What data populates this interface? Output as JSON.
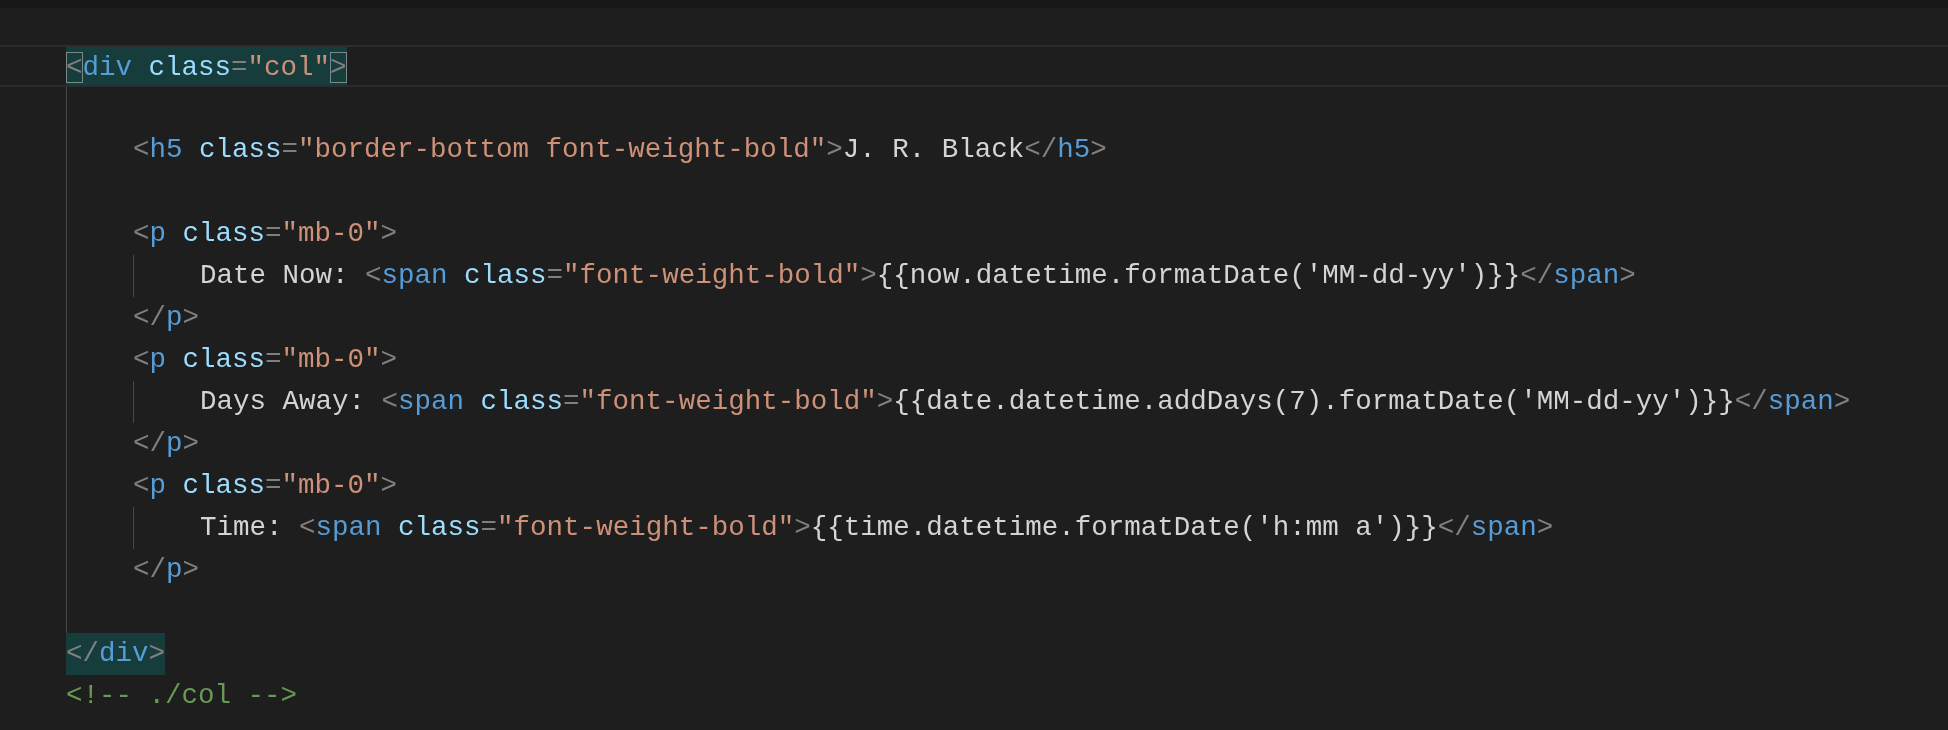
{
  "lines": [
    {
      "kind": "code",
      "current": true,
      "highlighted": true,
      "tokens": [
        {
          "kind": "punct",
          "text": "<",
          "boxed": true
        },
        {
          "kind": "tag",
          "text": "div",
          "boxed": false
        },
        {
          "kind": "attr",
          "text": " class",
          "boxed": false
        },
        {
          "kind": "punct",
          "text": "=",
          "boxed": false
        },
        {
          "kind": "string",
          "text": "\"col\"",
          "boxed": false
        },
        {
          "kind": "punct",
          "text": ">",
          "boxed": true
        }
      ],
      "children": [
        {
          "kind": "blank"
        },
        {
          "kind": "code",
          "current": false,
          "highlighted": false,
          "tokens": [
            {
              "kind": "punct",
              "text": "<"
            },
            {
              "kind": "tag",
              "text": "h5"
            },
            {
              "kind": "attr",
              "text": " class"
            },
            {
              "kind": "punct",
              "text": "="
            },
            {
              "kind": "string",
              "text": "\"border-bottom font-weight-bold\""
            },
            {
              "kind": "punct",
              "text": ">"
            },
            {
              "kind": "text",
              "text": "J. R. Black"
            },
            {
              "kind": "punct",
              "text": "</"
            },
            {
              "kind": "tag",
              "text": "h5"
            },
            {
              "kind": "punct",
              "text": ">"
            }
          ]
        },
        {
          "kind": "blank"
        },
        {
          "kind": "code",
          "current": false,
          "highlighted": false,
          "tokens": [
            {
              "kind": "punct",
              "text": "<"
            },
            {
              "kind": "tag",
              "text": "p"
            },
            {
              "kind": "attr",
              "text": " class"
            },
            {
              "kind": "punct",
              "text": "="
            },
            {
              "kind": "string",
              "text": "\"mb-0\""
            },
            {
              "kind": "punct",
              "text": ">"
            }
          ],
          "children": [
            {
              "kind": "code",
              "current": false,
              "highlighted": false,
              "tokens": [
                {
                  "kind": "text",
                  "text": "Date Now: "
                },
                {
                  "kind": "punct",
                  "text": "<"
                },
                {
                  "kind": "tag",
                  "text": "span"
                },
                {
                  "kind": "attr",
                  "text": " class"
                },
                {
                  "kind": "punct",
                  "text": "="
                },
                {
                  "kind": "string",
                  "text": "\"font-weight-bold\""
                },
                {
                  "kind": "punct",
                  "text": ">"
                },
                {
                  "kind": "text",
                  "text": "{{now.datetime.formatDate('MM-dd-yy')}}"
                },
                {
                  "kind": "punct",
                  "text": "</"
                },
                {
                  "kind": "tag",
                  "text": "span"
                },
                {
                  "kind": "punct",
                  "text": ">"
                }
              ]
            }
          ]
        },
        {
          "kind": "code",
          "current": false,
          "highlighted": false,
          "tokens": [
            {
              "kind": "punct",
              "text": "</"
            },
            {
              "kind": "tag",
              "text": "p"
            },
            {
              "kind": "punct",
              "text": ">"
            }
          ]
        },
        {
          "kind": "code",
          "current": false,
          "highlighted": false,
          "tokens": [
            {
              "kind": "punct",
              "text": "<"
            },
            {
              "kind": "tag",
              "text": "p"
            },
            {
              "kind": "attr",
              "text": " class"
            },
            {
              "kind": "punct",
              "text": "="
            },
            {
              "kind": "string",
              "text": "\"mb-0\""
            },
            {
              "kind": "punct",
              "text": ">"
            }
          ],
          "children": [
            {
              "kind": "code",
              "current": false,
              "highlighted": false,
              "tokens": [
                {
                  "kind": "text",
                  "text": "Days Away: "
                },
                {
                  "kind": "punct",
                  "text": "<"
                },
                {
                  "kind": "tag",
                  "text": "span"
                },
                {
                  "kind": "attr",
                  "text": " class"
                },
                {
                  "kind": "punct",
                  "text": "="
                },
                {
                  "kind": "string",
                  "text": "\"font-weight-bold\""
                },
                {
                  "kind": "punct",
                  "text": ">"
                },
                {
                  "kind": "text",
                  "text": "{{date.datetime.addDays(7).formatDate('MM-dd-yy')}}"
                },
                {
                  "kind": "punct",
                  "text": "</"
                },
                {
                  "kind": "tag",
                  "text": "span"
                },
                {
                  "kind": "punct",
                  "text": ">"
                }
              ]
            }
          ]
        },
        {
          "kind": "code",
          "current": false,
          "highlighted": false,
          "tokens": [
            {
              "kind": "punct",
              "text": "</"
            },
            {
              "kind": "tag",
              "text": "p"
            },
            {
              "kind": "punct",
              "text": ">"
            }
          ]
        },
        {
          "kind": "code",
          "current": false,
          "highlighted": false,
          "tokens": [
            {
              "kind": "punct",
              "text": "<"
            },
            {
              "kind": "tag",
              "text": "p"
            },
            {
              "kind": "attr",
              "text": " class"
            },
            {
              "kind": "punct",
              "text": "="
            },
            {
              "kind": "string",
              "text": "\"mb-0\""
            },
            {
              "kind": "punct",
              "text": ">"
            }
          ],
          "children": [
            {
              "kind": "code",
              "current": false,
              "highlighted": false,
              "tokens": [
                {
                  "kind": "text",
                  "text": "Time: "
                },
                {
                  "kind": "punct",
                  "text": "<"
                },
                {
                  "kind": "tag",
                  "text": "span"
                },
                {
                  "kind": "attr",
                  "text": " class"
                },
                {
                  "kind": "punct",
                  "text": "="
                },
                {
                  "kind": "string",
                  "text": "\"font-weight-bold\""
                },
                {
                  "kind": "punct",
                  "text": ">"
                },
                {
                  "kind": "text",
                  "text": "{{time.datetime.formatDate('h:mm a')}}"
                },
                {
                  "kind": "punct",
                  "text": "</"
                },
                {
                  "kind": "tag",
                  "text": "span"
                },
                {
                  "kind": "punct",
                  "text": ">"
                }
              ]
            }
          ]
        },
        {
          "kind": "code",
          "current": false,
          "highlighted": false,
          "tokens": [
            {
              "kind": "punct",
              "text": "</"
            },
            {
              "kind": "tag",
              "text": "p"
            },
            {
              "kind": "punct",
              "text": ">"
            }
          ]
        },
        {
          "kind": "blank"
        }
      ]
    },
    {
      "kind": "code",
      "current": false,
      "highlighted": true,
      "tokens": [
        {
          "kind": "punct",
          "text": "</"
        },
        {
          "kind": "tag",
          "text": "div"
        },
        {
          "kind": "punct",
          "text": ">"
        }
      ]
    },
    {
      "kind": "code",
      "current": false,
      "highlighted": false,
      "tokens": [
        {
          "kind": "comment",
          "text": "<!-- ./col -->"
        }
      ]
    }
  ]
}
